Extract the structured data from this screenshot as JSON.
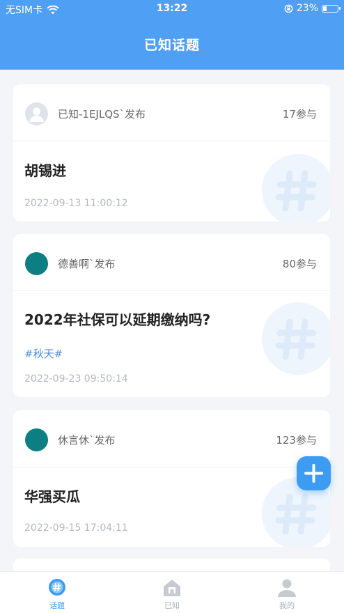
{
  "status_bar": {
    "carrier": "无SIM卡",
    "time": "13:22",
    "battery": "23%"
  },
  "header": {
    "title": "已知话题"
  },
  "topics": [
    {
      "author": "已知-1EJLQS`发布",
      "count": "17参与",
      "title": "胡锡进",
      "tag": "",
      "date": "2022-09-13 11:00:12",
      "avatar": "default-avatar-icon"
    },
    {
      "author": "德善啊`发布",
      "count": "80参与",
      "title": "2022年社保可以延期缴纳吗?",
      "tag": "#秋天#",
      "date": "2022-09-23 09:50:14",
      "avatar": "teal-avatar"
    },
    {
      "author": "休言休`发布",
      "count": "123参与",
      "title": "华强买瓜",
      "tag": "",
      "date": "2022-09-15 17:04:11",
      "avatar": "teal-avatar"
    }
  ],
  "tabs": [
    {
      "label": "话题",
      "icon": "topic-hash-icon",
      "active": true
    },
    {
      "label": "已知",
      "icon": "home-icon",
      "active": false
    },
    {
      "label": "我的",
      "icon": "user-icon",
      "active": false
    }
  ],
  "colors": {
    "accent": "#4f9ff5",
    "fab": "#3d9bf2",
    "tag": "#4f8fd6",
    "avatar_teal": "#0d7f83"
  },
  "fab": {
    "icon": "plus-icon"
  }
}
